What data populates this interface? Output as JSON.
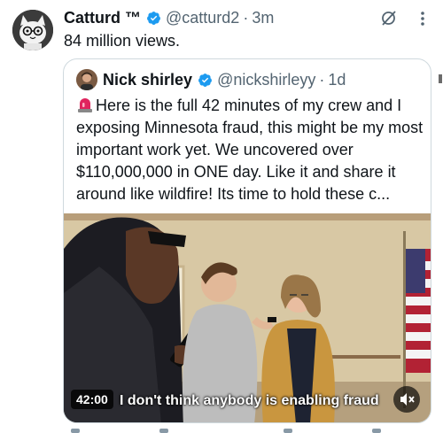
{
  "tweet": {
    "author_name": "Catturd ™",
    "handle": "@catturd2",
    "separator": "·",
    "time": "3m",
    "text": "84 million views.",
    "icons": {
      "avatar": "cartoon-cat-avatar",
      "verified": "verified-badge-icon",
      "grok": "grok-icon",
      "more": "more-options-icon"
    }
  },
  "quote": {
    "author_name": "Nick shirley",
    "handle": "@nickshirleyy",
    "separator": "·",
    "time": "1d",
    "text": "Here is the full 42 minutes of my crew and I exposing Minnesota fraud, this might be my most important work yet. We uncovered over $110,000,000 in ONE day. Like it and share it around like wildfire! Its time to hold these c...",
    "video": {
      "duration": "42:00",
      "caption": "I don't think anybody is enabling fraud",
      "icons": {
        "mute": "volume-muted-icon"
      }
    }
  },
  "colors": {
    "verified": "#1d9bf0",
    "secondary_text": "#536471",
    "border": "#cfd9de"
  }
}
